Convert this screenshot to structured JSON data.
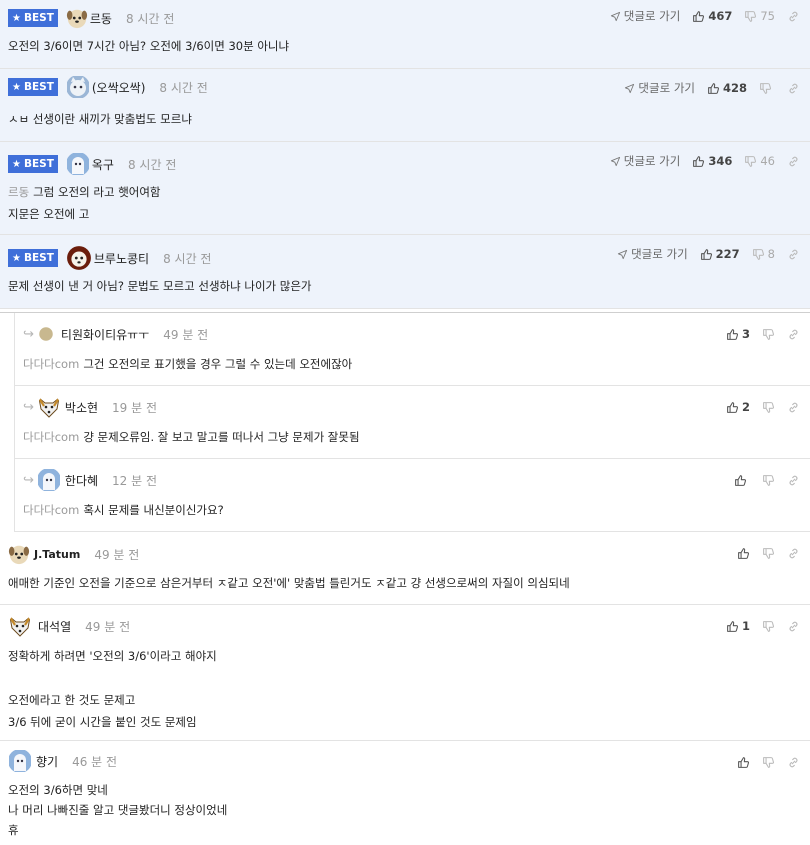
{
  "labels": {
    "best": "BEST",
    "goto_reply": "댓글로 가기"
  },
  "icons": {
    "star": "star-icon",
    "send": "send-arrow-icon",
    "thumb_up": "thumbs-up-icon",
    "thumb_down": "thumbs-down-icon",
    "link": "link-icon",
    "reply": "reply-arrow-icon"
  },
  "colors": {
    "best_bg": "#eef3fb",
    "badge": "#3f6fd9",
    "time": "#999999"
  },
  "best_comments": [
    {
      "nick": "르동",
      "time": "8 시간 전",
      "up": "467",
      "down": "75",
      "lines": [
        "오전의 3/6이면 7시간 아님? 오전에 3/6이면 30분 아니냐"
      ]
    },
    {
      "nick": "(오싹오싹)",
      "time": "8 시간 전",
      "up": "428",
      "down": "",
      "lines": [
        "ㅅㅂ 선생이란 새끼가 맞춤법도 모르냐"
      ]
    },
    {
      "nick": "옥구",
      "time": "8 시간 전",
      "up": "346",
      "down": "46",
      "mention": "르동",
      "lines": [
        "그럼 오전의 라고 햇어여함",
        "지문은 오전에 고"
      ]
    },
    {
      "nick": "브루노콩티",
      "time": "8 시간 전",
      "up": "227",
      "down": "8",
      "lines": [
        "문제 선생이 낸 거 아님? 문법도 모르고 선생하냐 나이가 많은가"
      ]
    }
  ],
  "replies": [
    {
      "nick": "티원화이티유ㅠㅜ",
      "time": "49 분 전",
      "up": "3",
      "mention": "다다다com",
      "lines": [
        "그건 오전의로 표기했을 경우 그럴 수 있는데 오전에잖아"
      ]
    },
    {
      "nick": "박소현",
      "time": "19 분 전",
      "up": "2",
      "mention": "다다다com",
      "lines": [
        "걍 문제오류임. 잘 보고 말고를 떠나서 그냥 문제가 잘못됨"
      ]
    },
    {
      "nick": "한다혜",
      "time": "12 분 전",
      "up": "",
      "mention": "다다다com",
      "lines": [
        "혹시 문제를 내신분이신가요?"
      ]
    }
  ],
  "comments": [
    {
      "nick": "J.Tatum",
      "time": "49 분 전",
      "up": "",
      "lines": [
        "애매한 기준인 오전을 기준으로 삼은거부터 ㅈ같고 오전'에' 맞춤법 틀린거도 ㅈ같고 걍 선생으로써의 자질이 의심되네"
      ]
    },
    {
      "nick": "대석열",
      "time": "49 분 전",
      "up": "1",
      "lines": [
        "정확하게 하려면 '오전의 3/6'이라고 해야지",
        "",
        "오전에라고 한 것도 문제고",
        "3/6 뒤에 굳이 시간을 붙인 것도 문제임"
      ]
    },
    {
      "nick": "향기",
      "time": "46 분 전",
      "up": "",
      "lines": [
        "오전의 3/6하면 맞네",
        "나 머리 나빠진줄 알고 댓글봤더니 정상이었네",
        "휴"
      ]
    }
  ]
}
